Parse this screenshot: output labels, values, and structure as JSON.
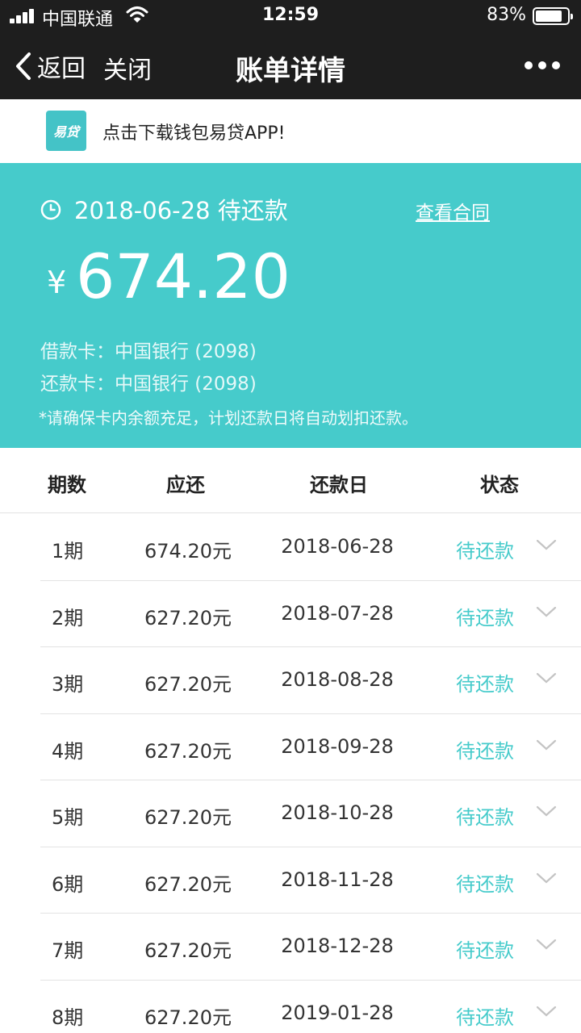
{
  "status_bar": {
    "carrier": "中国联通",
    "time": "12:59",
    "battery_percent": "83%",
    "battery_level": 0.83,
    "signal_bars": 4
  },
  "nav": {
    "back_label": "返回",
    "close_label": "关闭",
    "title": "账单详情"
  },
  "banner": {
    "logo_text": "易贷",
    "text": "点击下载钱包易贷APP!"
  },
  "hero": {
    "due_date": "2018-06-28",
    "due_status": "待还款",
    "contract_link": "查看合同",
    "currency": "¥",
    "amount": "674.20",
    "loan_card_label": "借款卡：",
    "loan_card_value": "中国银行 (2098)",
    "repay_card_label": "还款卡：",
    "repay_card_value": "中国银行 (2098)",
    "note": "*请确保卡内余额充足，计划还款日将自动划扣还款。"
  },
  "table": {
    "headers": {
      "period": "期数",
      "due": "应还",
      "date": "还款日",
      "status": "状态"
    },
    "rows": [
      {
        "period": "1期",
        "amount": "674.20元",
        "date": "2018-06-28",
        "status": "待还款"
      },
      {
        "period": "2期",
        "amount": "627.20元",
        "date": "2018-07-28",
        "status": "待还款"
      },
      {
        "period": "3期",
        "amount": "627.20元",
        "date": "2018-08-28",
        "status": "待还款"
      },
      {
        "period": "4期",
        "amount": "627.20元",
        "date": "2018-09-28",
        "status": "待还款"
      },
      {
        "period": "5期",
        "amount": "627.20元",
        "date": "2018-10-28",
        "status": "待还款"
      },
      {
        "period": "6期",
        "amount": "627.20元",
        "date": "2018-11-28",
        "status": "待还款"
      },
      {
        "period": "7期",
        "amount": "627.20元",
        "date": "2018-12-28",
        "status": "待还款"
      },
      {
        "period": "8期",
        "amount": "627.20元",
        "date": "2019-01-28",
        "status": "待还款"
      }
    ]
  },
  "colors": {
    "accent": "#46cbcb",
    "nav_bg": "#1e1e1e"
  }
}
